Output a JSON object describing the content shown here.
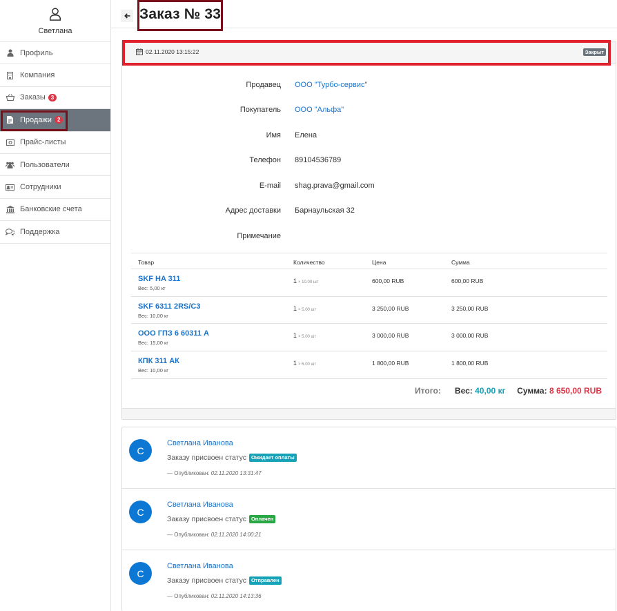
{
  "user": {
    "name": "Светлана"
  },
  "sidebar": {
    "items": [
      {
        "label": "Профиль",
        "icon": "user-icon"
      },
      {
        "label": "Компания",
        "icon": "building-icon"
      },
      {
        "label": "Заказы",
        "icon": "basket-icon",
        "badge": "3"
      },
      {
        "label": "Продажи",
        "icon": "document-icon",
        "badge": "2",
        "active": true
      },
      {
        "label": "Прайс-листы",
        "icon": "money-icon"
      },
      {
        "label": "Пользователи",
        "icon": "users-icon"
      },
      {
        "label": "Сотрудники",
        "icon": "id-card-icon"
      },
      {
        "label": "Банковские счета",
        "icon": "bank-icon"
      },
      {
        "label": "Поддержка",
        "icon": "chat-icon"
      }
    ]
  },
  "header": {
    "back_icon": "arrow-left-icon",
    "title": "Заказ № 33"
  },
  "order": {
    "date": "02.11.2020 13:15:22",
    "status": "Закрыт",
    "fields": {
      "seller_label": "Продавец",
      "seller_value": "ООО \"Турбо-сервис\"",
      "buyer_label": "Покупатель",
      "buyer_value": "ООО \"Альфа\"",
      "name_label": "Имя",
      "name_value": "Елена",
      "phone_label": "Телефон",
      "phone_value": "89104536789",
      "email_label": "E-mail",
      "email_value": "shag.prava@gmail.com",
      "address_label": "Адрес доставки",
      "address_value": "Барнаульская 32",
      "note_label": "Примечание",
      "note_value": ""
    },
    "table": {
      "headers": {
        "product": "Товар",
        "qty": "Количество",
        "price": "Цена",
        "sum": "Сумма"
      },
      "rows": [
        {
          "name": "SKF HA 311",
          "weight": "Вес: 5,00 кг",
          "qty": "1",
          "qty_unit": "× 10.00 шт",
          "price": "600,00 RUB",
          "sum": "600,00 RUB"
        },
        {
          "name": "SKF 6311 2RS/C3",
          "weight": "Вес: 10,00 кг",
          "qty": "1",
          "qty_unit": "× 5.00 шт",
          "price": "3 250,00 RUB",
          "sum": "3 250,00 RUB"
        },
        {
          "name": "ООО ГПЗ 6 60311 А",
          "weight": "Вес: 15,00 кг",
          "qty": "1",
          "qty_unit": "× 5.00 шт",
          "price": "3 000,00 RUB",
          "sum": "3 000,00 RUB"
        },
        {
          "name": "КПК 311 АК",
          "weight": "Вес: 10,00 кг",
          "qty": "1",
          "qty_unit": "× 6.00 шт",
          "price": "1 800,00 RUB",
          "sum": "1 800,00 RUB"
        }
      ]
    },
    "totals": {
      "total_label": "Итого:",
      "weight_label": "Вес:",
      "weight_value": "40,00 кг",
      "sum_label": "Сумма:",
      "sum_value": "8 650,00 RUB"
    }
  },
  "comments": [
    {
      "avatar": "С",
      "author": "Светлана Иванова",
      "text": "Заказу присвоен статус",
      "status": "Ожидает оплаты",
      "status_color": "#17a2b8",
      "meta_label": "— Опубликован:",
      "meta_date": "02.11.2020 13:31:47"
    },
    {
      "avatar": "С",
      "author": "Светлана Иванова",
      "text": "Заказу присвоен статус",
      "status": "Оплачен",
      "status_color": "#28a745",
      "meta_label": "— Опубликован:",
      "meta_date": "02.11.2020 14:00:21"
    },
    {
      "avatar": "С",
      "author": "Светлана Иванова",
      "text": "Заказу присвоен статус",
      "status": "Отправлен",
      "status_color": "#17a2b8",
      "meta_label": "— Опубликован:",
      "meta_date": "02.11.2020 14:13:36"
    }
  ]
}
